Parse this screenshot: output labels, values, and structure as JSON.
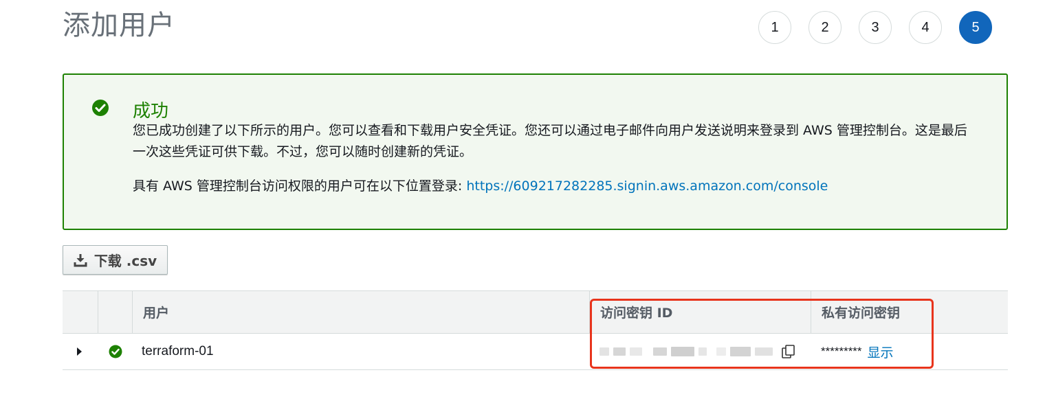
{
  "header": {
    "title": "添加用户",
    "steps": [
      "1",
      "2",
      "3",
      "4",
      "5"
    ],
    "active_step": "5"
  },
  "alert": {
    "title": "成功",
    "body": "您已成功创建了以下所示的用户。您可以查看和下载用户安全凭证。您还可以通过电子邮件向用户发送说明来登录到 AWS 管理控制台。这是最后一次这些凭证可供下载。不过，您可以随时创建新的凭证。",
    "signin_prefix": "具有 AWS 管理控制台访问权限的用户可在以下位置登录: ",
    "signin_url": "https://609217282285.signin.aws.amazon.com/console",
    "icon": "check-circle-icon",
    "color": "#1d8102"
  },
  "toolbar": {
    "download_label": "下载 .csv",
    "download_icon": "download-icon"
  },
  "table": {
    "columns": [
      "",
      "",
      "用户",
      "访问密钥 ID",
      "私有访问密钥"
    ],
    "rows": [
      {
        "user": "terraform-01",
        "status_icon": "check-circle-icon",
        "secret_masked": "*********",
        "show_label": "显示"
      }
    ]
  },
  "colors": {
    "accent": "#1166bb",
    "link": "#0073bb",
    "success": "#1d8102",
    "highlight": "#e8341c"
  }
}
